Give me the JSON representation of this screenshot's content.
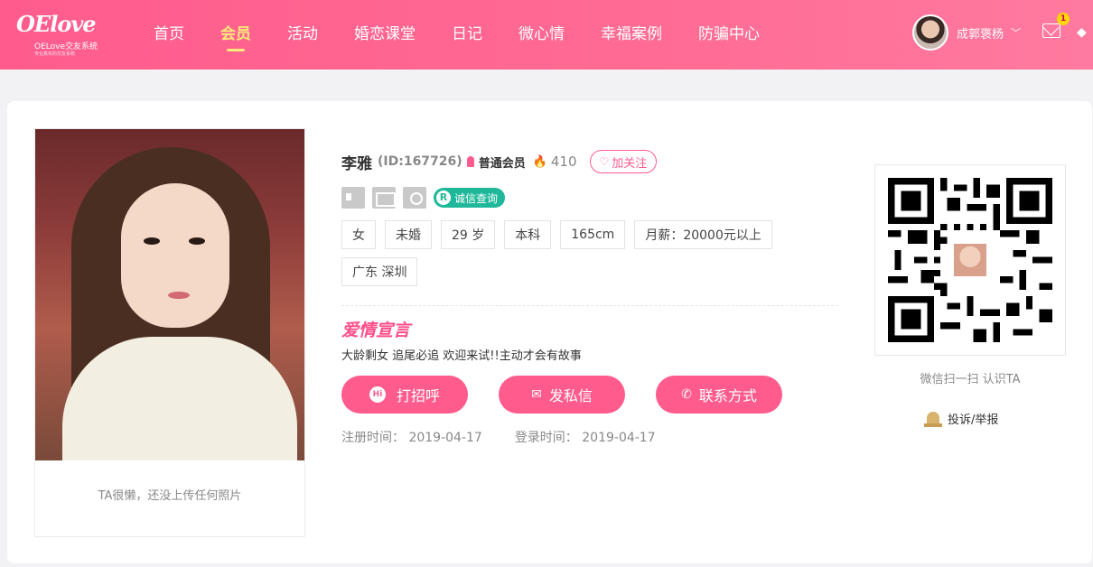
{
  "header": {
    "logo_script": "OElove",
    "logo_sub": "OELove交友系统",
    "logo_tiny": "专业真实的交友系统",
    "nav": [
      "首页",
      "会员",
      "活动",
      "婚恋课堂",
      "日记",
      "微心情",
      "幸福案例",
      "防骗中心"
    ],
    "nav_active": "会员",
    "user_name": "成郭褒杨",
    "mail_count": "1"
  },
  "profile": {
    "name": "李雅",
    "id": "(ID:167726)",
    "member_type": "普通会员",
    "heat": "410",
    "follow_label": "加关注",
    "credit_label": "诚信查询",
    "tags": [
      "女",
      "未婚",
      "29 岁",
      "本科",
      "165cm",
      "月薪：20000元以上",
      "广东 深圳"
    ],
    "declaration_title": "爱情宣言",
    "declaration": "大龄剩女 追尾必追 欢迎来试!!主动才会有故事",
    "buttons": {
      "greet": "打招呼",
      "message": "发私信",
      "contact": "联系方式",
      "greet_badge": "Hi"
    },
    "register": "注册时间： 2019-04-17",
    "login": "登录时间： 2019-04-17",
    "photo_caption": "TA很懒，还没上传任何照片"
  },
  "side": {
    "qr_caption": "微信扫一扫 认识TA",
    "report_label": "投诉/举报"
  },
  "colors": {
    "accent": "#ff5c8d",
    "active_nav": "#ffe97a",
    "credit": "#1fb89a"
  }
}
